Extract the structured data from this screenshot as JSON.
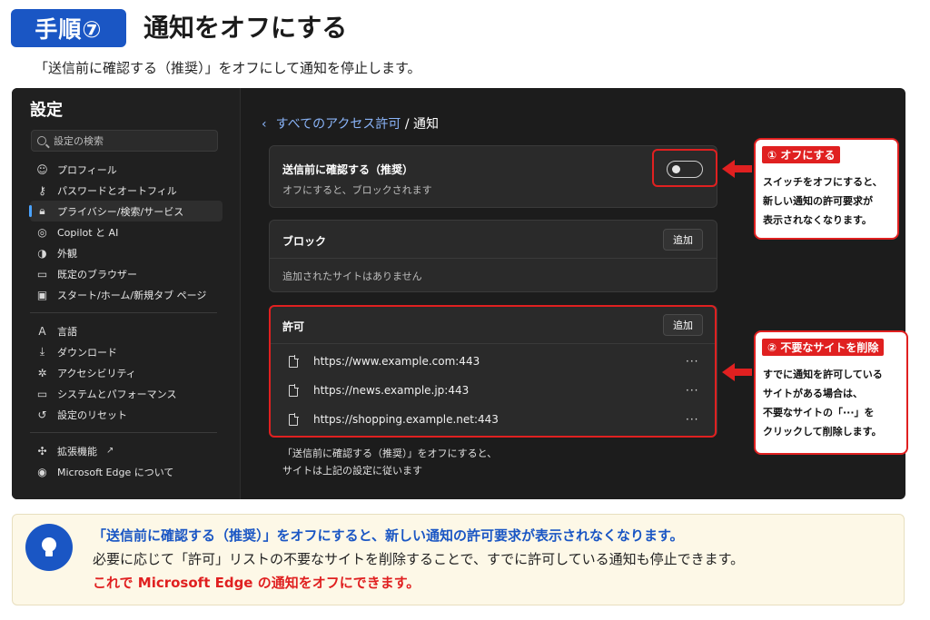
{
  "header": {
    "step_badge": "手順⑦",
    "title": "通知をオフにする",
    "subtitle": "「送信前に確認する（推奨）」をオフにして通知を停止します。"
  },
  "sidebar": {
    "title": "設定",
    "search_placeholder": "設定の検索",
    "groups": [
      [
        {
          "label": "プロフィール",
          "icon": "profile-icon"
        },
        {
          "label": "パスワードとオートフィル",
          "icon": "key-icon"
        },
        {
          "label": "プライバシー/検索/サービス",
          "icon": "lock-icon",
          "active": true
        },
        {
          "label": "Copilot と AI",
          "icon": "copilot-icon"
        },
        {
          "label": "外観",
          "icon": "palette-icon"
        },
        {
          "label": "既定のブラウザー",
          "icon": "browser-icon"
        },
        {
          "label": "スタート/ホーム/新規タブ ページ",
          "icon": "home-icon"
        }
      ],
      [
        {
          "label": "言語",
          "icon": "language-icon"
        },
        {
          "label": "ダウンロード",
          "icon": "download-icon"
        },
        {
          "label": "アクセシビリティ",
          "icon": "accessibility-icon"
        },
        {
          "label": "システムとパフォーマンス",
          "icon": "laptop-icon"
        },
        {
          "label": "設定のリセット",
          "icon": "reset-icon"
        }
      ],
      [
        {
          "label": "拡張機能",
          "icon": "extension-icon",
          "external": true
        },
        {
          "label": "Microsoft Edge について",
          "icon": "edge-icon"
        }
      ]
    ]
  },
  "content": {
    "breadcrumb_link": "すべてのアクセス許可",
    "breadcrumb_sep": " / ",
    "breadcrumb_current": "通知",
    "ask_card": {
      "title": "送信前に確認する（推奨）",
      "desc": "オフにすると、ブロックされます",
      "toggle_on": false
    },
    "block_card": {
      "title": "ブロック",
      "add_label": "追加",
      "empty_text": "追加されたサイトはありません"
    },
    "allow_card": {
      "title": "許可",
      "add_label": "追加",
      "sites": [
        {
          "url": "https://www.example.com:443",
          "more": "···"
        },
        {
          "url": "https://news.example.jp:443",
          "more": "···"
        },
        {
          "url": "https://shopping.example.net:443",
          "more": "···"
        }
      ]
    },
    "footnote_line1": "「送信前に確認する（推奨）」をオフにすると、",
    "footnote_line2": "サイトは上記の設定に従います"
  },
  "callouts": {
    "one": {
      "tag": "① オフにする",
      "lines": [
        "スイッチをオフにすると、",
        "新しい通知の許可要求が",
        "表示されなくなります。"
      ]
    },
    "two": {
      "tag": "② 不要なサイトを削除",
      "lines": [
        "すでに通知を許可している",
        "サイトがある場合は、",
        "不要なサイトの「···」を",
        "クリックして削除します。"
      ]
    }
  },
  "tip": {
    "line1": "「送信前に確認する（推奨）」をオフにすると、新しい通知の許可要求が表示されなくなります。",
    "line2": "必要に応じて「許可」リストの不要なサイトを削除することで、すでに許可している通知も停止できます。",
    "line3": "これで Microsoft Edge の通知をオフにできます。"
  },
  "colors": {
    "accent_blue": "#1a56c4",
    "annotation_red": "#e02020",
    "link_blue": "#8ab4f8",
    "tip_background": "#fdf8e7"
  }
}
